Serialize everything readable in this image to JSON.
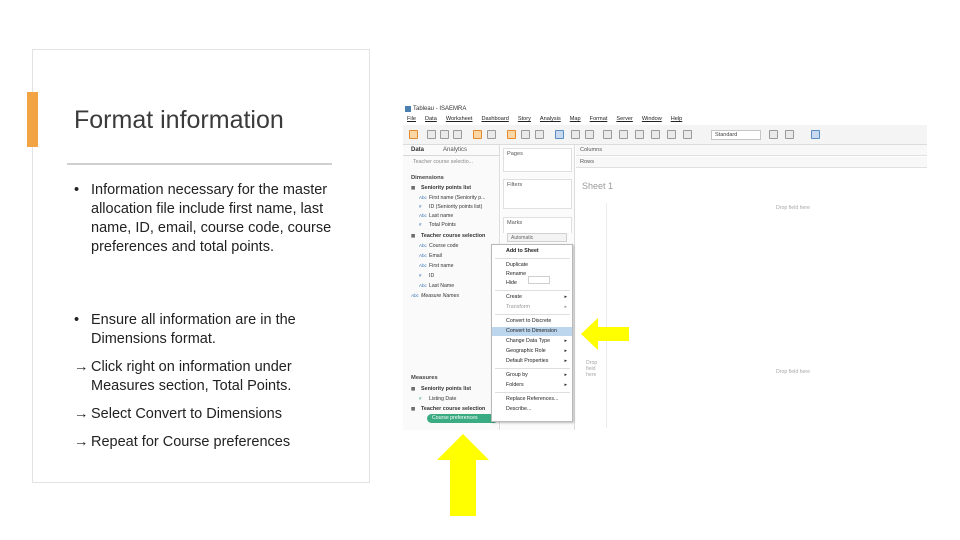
{
  "slide": {
    "title": "Format information",
    "bullets": [
      {
        "marker": "•",
        "text": "Information necessary for the master allocation file include first name, last name, ID, email, course code, course preferences and total points."
      },
      {
        "marker": "•",
        "text": "Ensure all information are in the Dimensions format."
      }
    ],
    "steps": [
      {
        "marker": "→",
        "text": "Click right on information under Measures section, Total Points."
      },
      {
        "marker": "→",
        "text": "Select Convert to Dimensions"
      },
      {
        "marker": "→",
        "text": "Repeat for Course preferences"
      }
    ],
    "colors": {
      "accent": "#f2a445",
      "arrow": "#ffff00",
      "pill": "#3bab82",
      "highlight": "#bcd6ee"
    }
  },
  "tableau": {
    "window_title": "Tableau - ISAEMRA",
    "menu": [
      "File",
      "Data",
      "Worksheet",
      "Dashboard",
      "Story",
      "Analysis",
      "Map",
      "Format",
      "Server",
      "Window",
      "Help"
    ],
    "toolbar": {
      "mark_select": "Standard"
    },
    "data_pane": {
      "tab_data": "Data",
      "tab_analytics": "Analytics",
      "datasource": "Teacher course selectio...",
      "dimensions_header": "Dimensions",
      "measures_header": "Measures",
      "dim_groups": [
        {
          "name": "Seniority points list",
          "fields": [
            {
              "icon": "Abc",
              "name": "First name (Seniority p..."
            },
            {
              "icon": "#",
              "name": "ID (Seniority points list)"
            },
            {
              "icon": "Abc",
              "name": "Last name"
            },
            {
              "icon": "#",
              "name": "Total Points"
            }
          ]
        },
        {
          "name": "Teacher course selection",
          "fields": [
            {
              "icon": "Abc",
              "name": "Course code"
            },
            {
              "icon": "Abc",
              "name": "Email"
            },
            {
              "icon": "Abc",
              "name": "First name"
            },
            {
              "icon": "#",
              "name": "ID"
            },
            {
              "icon": "Abc",
              "name": "Last Name"
            }
          ]
        }
      ],
      "measure_names": {
        "icon": "Abc",
        "name": "Measure Names"
      },
      "meas_groups": [
        {
          "name": "Seniority points list",
          "fields": [
            {
              "icon": "#",
              "name": "Listing Date"
            }
          ]
        },
        {
          "name": "Teacher course selection",
          "fields": []
        }
      ],
      "selected_pill": "Course preferences"
    },
    "shelves": {
      "pages": "Pages",
      "filters": "Filters",
      "marks": "Marks",
      "marks_type": "Automatic",
      "columns": "Columns",
      "rows": "Rows"
    },
    "canvas": {
      "sheet_title": "Sheet 1",
      "drop_field_top": "Drop field here",
      "drop_field_left": "Drop field here",
      "drop_field_right": "Drop field here"
    },
    "context_menu": [
      {
        "label": "Add to Sheet",
        "bold": true
      },
      {
        "label": "Duplicate"
      },
      {
        "label": "Rename"
      },
      {
        "label": "Hide"
      },
      {
        "label": "Create",
        "sub": "▸"
      },
      {
        "label": "Transform",
        "sub": "▸",
        "dim": true
      },
      {
        "label": "Convert to Discrete"
      },
      {
        "label": "Convert to Dimension",
        "highlight": true
      },
      {
        "label": "Change Data Type",
        "sub": "▸"
      },
      {
        "label": "Geographic Role",
        "sub": "▸"
      },
      {
        "label": "Default Properties",
        "sub": "▸"
      },
      {
        "label": "Group by",
        "sub": "▸"
      },
      {
        "label": "Folders",
        "sub": "▸"
      },
      {
        "label": "Replace References..."
      },
      {
        "label": "Describe..."
      }
    ]
  }
}
